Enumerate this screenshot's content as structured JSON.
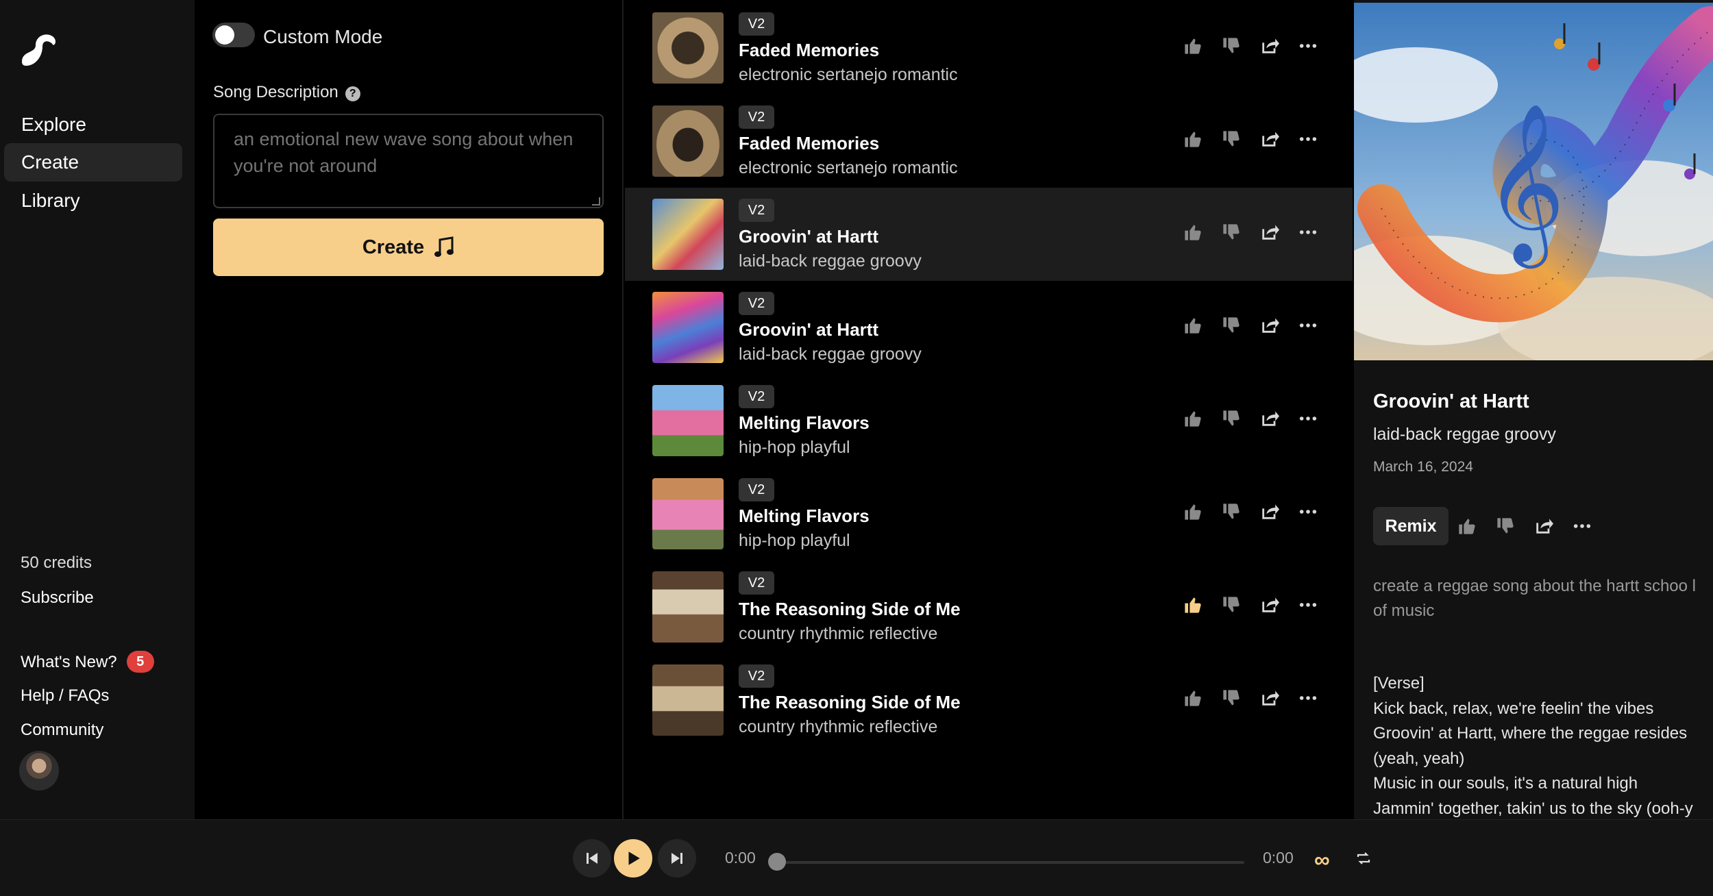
{
  "sidebar": {
    "nav": [
      "Explore",
      "Create",
      "Library"
    ],
    "credits": "50 credits",
    "subscribe": "Subscribe",
    "whats_new": "What's New?",
    "whats_new_badge": "5",
    "help": "Help / FAQs",
    "community": "Community"
  },
  "create": {
    "custom_mode_label": "Custom Mode",
    "description_label": "Song Description",
    "description_placeholder": "an emotional new wave song about when you're not around",
    "create_button": "Create"
  },
  "songs": [
    {
      "version": "V2",
      "title": "Faded Memories",
      "tags": "electronic sertanejo romantic",
      "liked": false
    },
    {
      "version": "V2",
      "title": "Faded Memories",
      "tags": "electronic sertanejo romantic",
      "liked": false
    },
    {
      "version": "V2",
      "title": "Groovin' at Hartt",
      "tags": "laid-back reggae groovy",
      "liked": false,
      "selected": true
    },
    {
      "version": "V2",
      "title": "Groovin' at Hartt",
      "tags": "laid-back reggae groovy",
      "liked": false
    },
    {
      "version": "V2",
      "title": "Melting Flavors",
      "tags": "hip-hop playful",
      "liked": false
    },
    {
      "version": "V2",
      "title": "Melting Flavors",
      "tags": "hip-hop playful",
      "liked": false
    },
    {
      "version": "V2",
      "title": "The Reasoning Side of Me",
      "tags": "country rhythmic reflective",
      "liked": true
    },
    {
      "version": "V2",
      "title": "The Reasoning Side of Me",
      "tags": "country rhythmic reflective",
      "liked": false
    }
  ],
  "detail": {
    "title": "Groovin' at Hartt",
    "tags": "laid-back reggae groovy",
    "date": "March 16, 2024",
    "remix": "Remix",
    "prompt": "create a reggae song about the hartt schoo l of music",
    "lyrics": "[Verse]\nKick back, relax, we're feelin' the vibes\nGroovin' at Hartt, where the reggae resides\n(yeah, yeah)\nMusic in our souls, it's a natural high\nJammin' together, takin' us to the sky (ooh-y"
  },
  "player": {
    "current_time": "0:00",
    "total_time": "0:00",
    "progress": 0
  },
  "colors": {
    "accent": "#f7cf8a",
    "badge": "#e0403c",
    "liked": "#f7cf8a"
  }
}
